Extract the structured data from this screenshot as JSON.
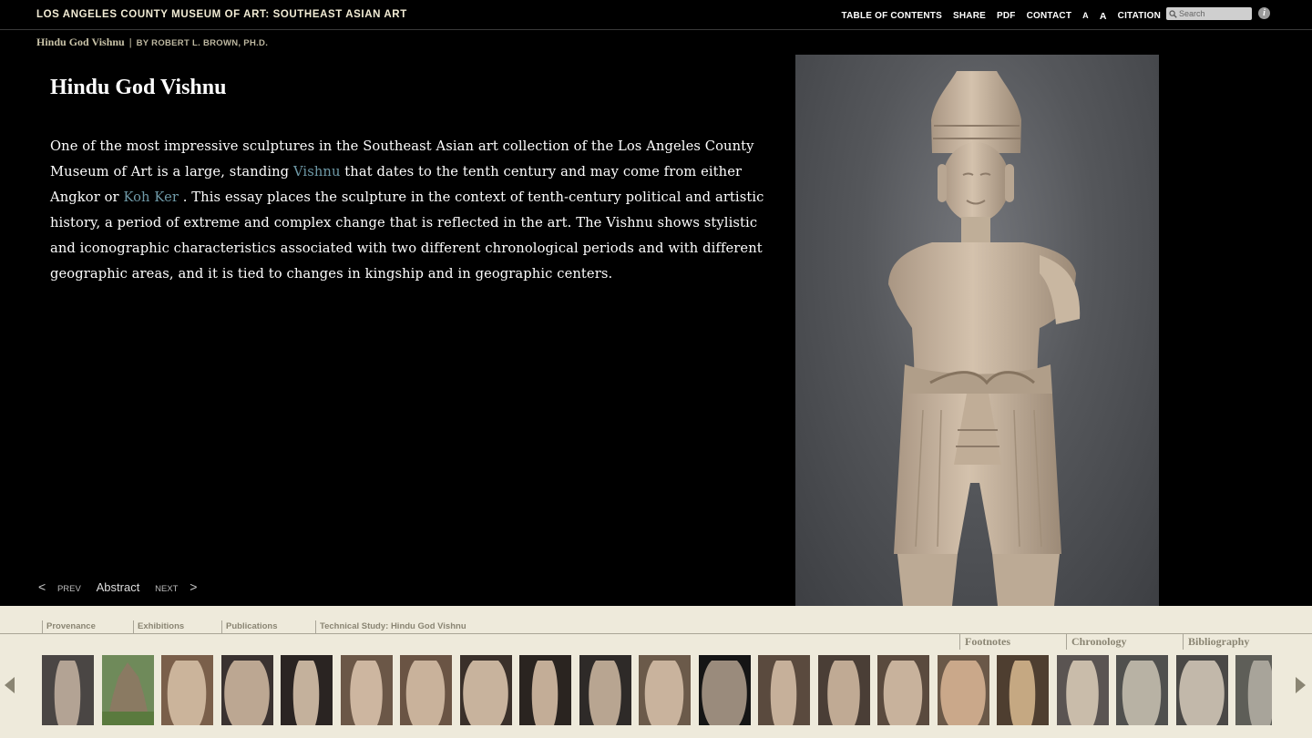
{
  "header": {
    "site_title": "LOS ANGELES COUNTY MUSEUM OF ART: SOUTHEAST ASIAN ART",
    "nav": [
      "TABLE OF CONTENTS",
      "SHARE",
      "PDF",
      "CONTACT",
      "A",
      "A",
      "CITATION"
    ],
    "search_placeholder": "Search",
    "info_label": "i"
  },
  "breadcrumb": {
    "title": "Hindu God Vishnu",
    "separator": "|",
    "author": "BY ROBERT L. BROWN, PH.D."
  },
  "main": {
    "heading": "Hindu God Vishnu",
    "abstract": {
      "part1": "One of the most impressive sculptures in the Southeast Asian art collection of the Los Angeles County Museum of Art is a large, standing ",
      "link1": "Vishnu",
      "part2": " that dates to the tenth century and may come from either Angkor or ",
      "link2": "Koh Ker",
      "part3": " . This essay places the sculpture in the context of tenth-century political and artistic history, a period of extreme and complex change that is reflected in the art. The Vishnu shows stylistic and iconographic characteristics associated with two different chronological periods and with different geographic areas, and it is tied to changes in kingship and in geographic centers."
    }
  },
  "pager": {
    "prev_arrow": "<",
    "prev": "PREV",
    "current": "Abstract",
    "next": "NEXT",
    "next_arrow": ">"
  },
  "bottom": {
    "tabs": [
      "Provenance",
      "Exhibitions",
      "Publications",
      "Technical Study: Hindu God Vishnu"
    ],
    "secondary_tabs": [
      "Footnotes",
      "Chronology",
      "Bibliography"
    ],
    "thumb_count": 21
  },
  "colors": {
    "accent_link": "#6f9aa8",
    "panel_bg": "#eeeadb",
    "tab_text": "#8a8573"
  }
}
